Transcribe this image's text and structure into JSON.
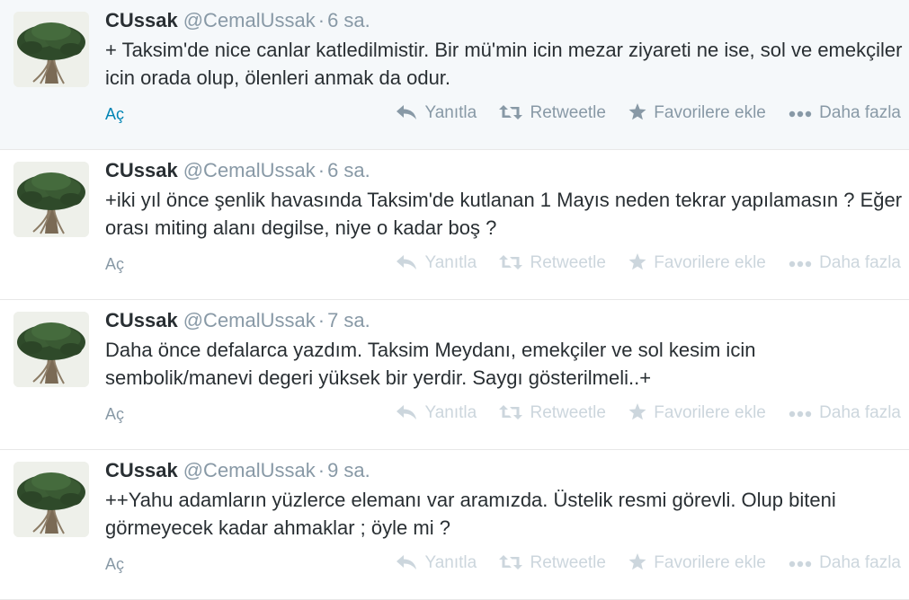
{
  "tweets": [
    {
      "fullname": "CUssak",
      "username": "@CemalUssak",
      "separator": "·",
      "time": "6 sa.",
      "text": "+ Taksim'de nice canlar katledilmistir. Bir mü'min icin mezar ziyareti ne ise, sol ve emekçiler icin orada olup, ölenleri anmak da odur.",
      "expand": "Aç",
      "actions": {
        "reply": "Yanıtla",
        "retweet": "Retweetle",
        "favorite": "Favorilere ekle",
        "more": "Daha fazla"
      }
    },
    {
      "fullname": "CUssak",
      "username": "@CemalUssak",
      "separator": "·",
      "time": "6 sa.",
      "text": "+iki yıl önce şenlik havasında Taksim'de kutlanan 1 Mayıs neden tekrar yapılamasın ? Eğer orası miting alanı degilse, niye o kadar boş ?",
      "expand": "Aç",
      "actions": {
        "reply": "Yanıtla",
        "retweet": "Retweetle",
        "favorite": "Favorilere ekle",
        "more": "Daha fazla"
      }
    },
    {
      "fullname": "CUssak",
      "username": "@CemalUssak",
      "separator": "·",
      "time": "7 sa.",
      "text": "Daha önce defalarca yazdım. Taksim Meydanı, emekçiler ve sol kesim icin sembolik/manevi degeri yüksek bir yerdir. Saygı gösterilmeli..+",
      "expand": "Aç",
      "actions": {
        "reply": "Yanıtla",
        "retweet": "Retweetle",
        "favorite": "Favorilere ekle",
        "more": "Daha fazla"
      }
    },
    {
      "fullname": "CUssak",
      "username": "@CemalUssak",
      "separator": "·",
      "time": "9 sa.",
      "text": "++Yahu adamların yüzlerce elemanı var aramızda. Üstelik resmi görevli. Olup biteni görmeyecek kadar ahmaklar ; öyle mi ?",
      "expand": "Aç",
      "actions": {
        "reply": "Yanıtla",
        "retweet": "Retweetle",
        "favorite": "Favorilere ekle",
        "more": "Daha fazla"
      }
    }
  ],
  "colors": {
    "hover_background": "#f5f8fa",
    "link": "#0084b4",
    "muted": "#8899a6",
    "faded": "#ccd6dd",
    "text": "#292f33"
  },
  "icons": {
    "avatar": "tree-avatar-image",
    "reply": "reply-arrow-icon",
    "retweet": "retweet-icon",
    "favorite": "star-icon",
    "more": "ellipsis-icon"
  }
}
